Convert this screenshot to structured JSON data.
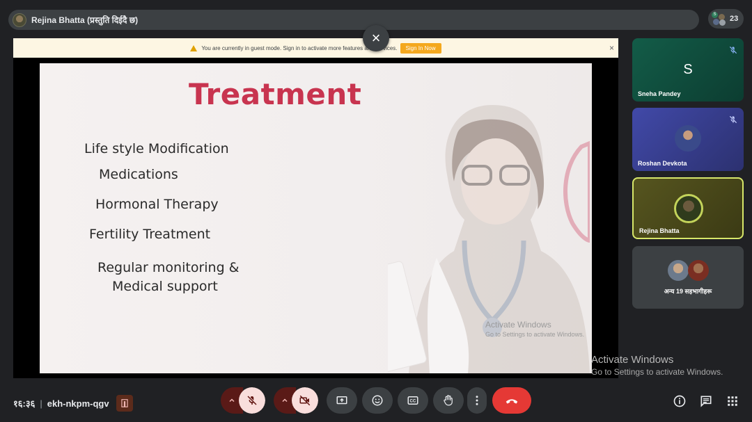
{
  "top_bar": {
    "title": "Rejina Bhatta (प्रस्तुति दिईदै छ)"
  },
  "participants": {
    "count": "23",
    "mini_label": "S"
  },
  "banner": {
    "message": "You are currently in guest mode. Sign in to activate more features and services.",
    "signin_label": "Sign In Now",
    "close_symbol": "×"
  },
  "overlay_close": {
    "symbol": "×"
  },
  "slide": {
    "title": "Treatment",
    "lines": [
      "Life style Modification",
      "Medications",
      "Hormonal Therapy",
      "Fertility Treatment",
      "Regular monitoring &",
      "Medical support"
    ],
    "watermark_title": "Activate Windows",
    "watermark_sub": "Go to Settings to activate Windows."
  },
  "tiles": [
    {
      "name": "Sneha Pandey",
      "initial": "S",
      "muted": true,
      "color": "#0f4f3e"
    },
    {
      "name": "Roshan Devkota",
      "muted": true,
      "color": "#3a3f8f"
    },
    {
      "name": "Rejina Bhatta",
      "muted": false,
      "speaking": true,
      "color": "#4a4a1f"
    },
    {
      "name": "अन्य 19 सहभागीहरू",
      "color": "#3c4043"
    }
  ],
  "os_watermark": {
    "title": "Activate Windows",
    "sub": "Go to Settings to activate Windows."
  },
  "meeting": {
    "time": "१६:३६",
    "separator": "|",
    "code": "ekh-nkpm-qgv"
  },
  "controls": {
    "mic_muted": true,
    "camera_off": true,
    "icons": [
      "chevron-up-icon",
      "mic-off-icon",
      "chevron-up-icon",
      "camera-off-icon",
      "present-screen-icon",
      "emoji-icon",
      "captions-icon",
      "raise-hand-icon",
      "more-options-icon",
      "hang-up-icon",
      "info-icon",
      "chat-icon",
      "activities-icon"
    ]
  },
  "colors": {
    "accent_red": "#c8344f",
    "hangup": "#e53935",
    "banner_button": "#f4a81d",
    "speaking_border": "#d7e76a"
  }
}
